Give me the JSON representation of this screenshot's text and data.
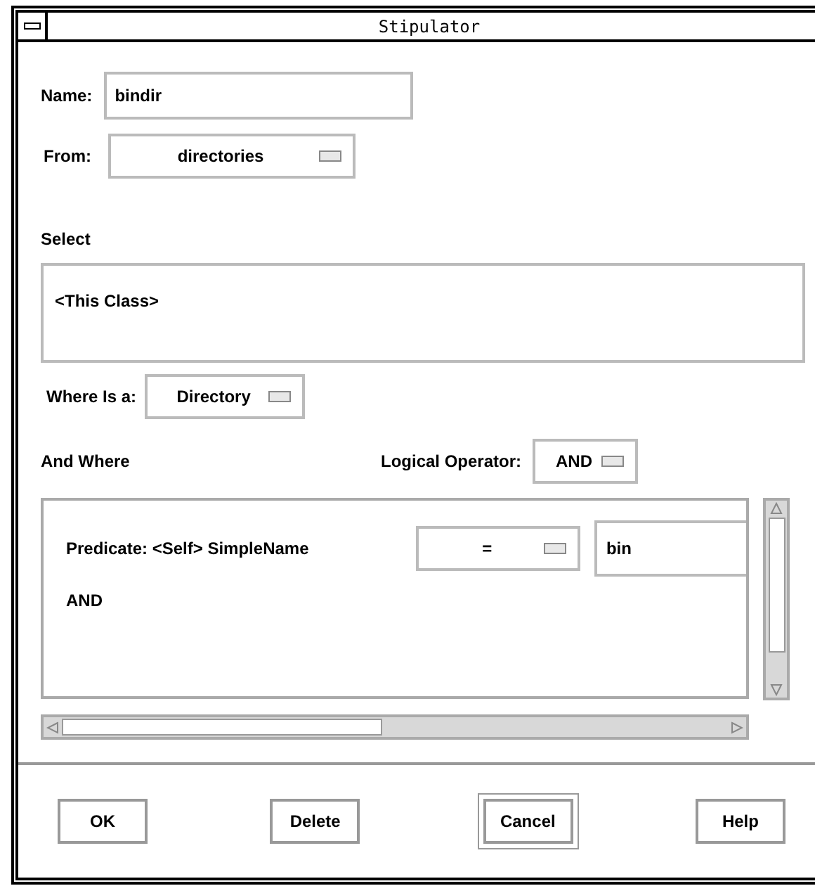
{
  "window": {
    "title": "Stipulator"
  },
  "name": {
    "label": "Name:",
    "value": "bindir"
  },
  "from": {
    "label": "From:",
    "value": "directories"
  },
  "select": {
    "label": "Select",
    "items": [
      "<This Class>"
    ]
  },
  "where_is_a": {
    "label": "Where Is a:",
    "value": "Directory"
  },
  "and_where": {
    "label": "And Where"
  },
  "logical_operator": {
    "label": "Logical Operator:",
    "value": "AND"
  },
  "predicates": [
    {
      "label": "Predicate: <Self> SimpleName",
      "operator": "=",
      "value": "bin"
    }
  ],
  "connector": "AND",
  "buttons": [
    {
      "label": "OK",
      "default": false
    },
    {
      "label": "Delete",
      "default": false
    },
    {
      "label": "Cancel",
      "default": true
    },
    {
      "label": "Help",
      "default": false
    }
  ]
}
